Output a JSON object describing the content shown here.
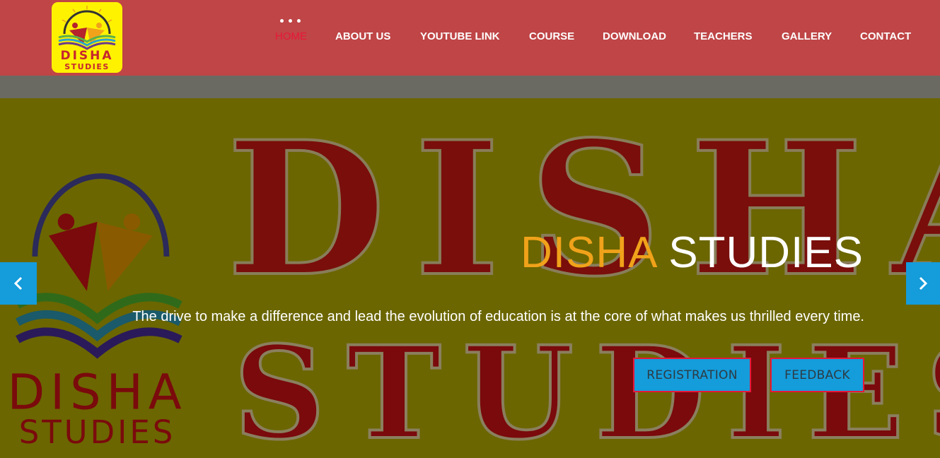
{
  "logo": {
    "line1": "DISHA",
    "line2": "STUDIES"
  },
  "nav": {
    "items": [
      {
        "label": "HOME",
        "active": true
      },
      {
        "label": "ABOUT US"
      },
      {
        "label": "YOUTUBE LINK"
      },
      {
        "label": "COURSE"
      },
      {
        "label": "DOWNLOAD"
      },
      {
        "label": "TEACHERS"
      },
      {
        "label": "GALLERY"
      },
      {
        "label": "CONTACT"
      }
    ]
  },
  "hero": {
    "title_accent": "DISHA",
    "title_rest": " STUDIES",
    "subtitle": "The drive to make a difference and lead the evolution of education is at the core of what makes us thrilled every time.",
    "buttons": {
      "registration": "REGISTRATION",
      "feedback": "FEEDBACK"
    },
    "background_text": {
      "line1": "DISHA",
      "line2": "STUDIES"
    }
  },
  "colors": {
    "header": "#bf4546",
    "accent": "#f0a21a",
    "active_nav": "#e8173a",
    "button": "#149cdb"
  },
  "icons": {
    "prev": "chevron-left-icon",
    "next": "chevron-right-icon",
    "menu": "dots-icon"
  }
}
